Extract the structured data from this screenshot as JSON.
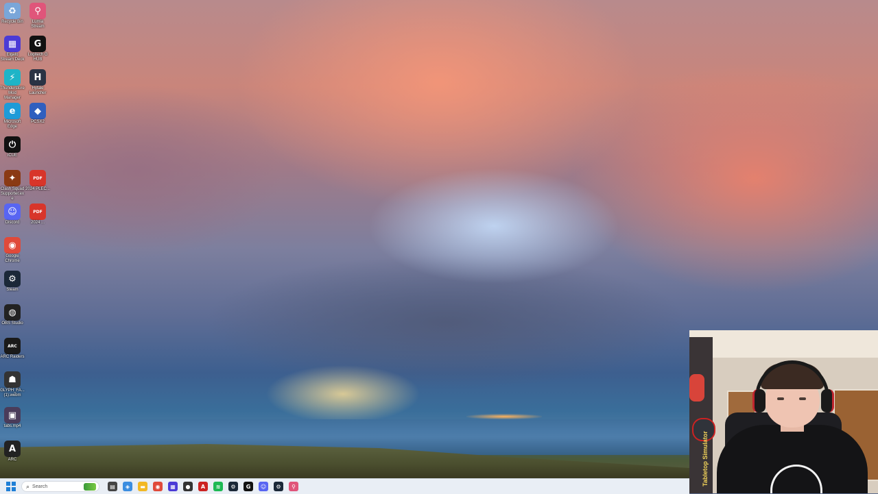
{
  "desktop": {
    "icons": [
      {
        "label": "Recycle Bin",
        "icon": "recycle-bin-icon",
        "color": "#7aa6d9",
        "glyph": "♻"
      },
      {
        "label": "Lumia Stream",
        "icon": "map-pin-icon",
        "color": "#e0557a",
        "glyph": "⚲"
      },
      {
        "label": "Elgato Stream Deck",
        "icon": "stream-deck-icon",
        "color": "#4b3bd6",
        "glyph": "▦"
      },
      {
        "label": "Logitech G HUB",
        "icon": "logitech-g-icon",
        "color": "#111111",
        "glyph": "G"
      },
      {
        "label": "Thunderstore Mod Manager",
        "icon": "thunderstore-icon",
        "color": "#1fb4c7",
        "glyph": "⚡"
      },
      {
        "label": "Hytale Launcher",
        "icon": "hytale-icon",
        "color": "#2a3344",
        "glyph": "H"
      },
      {
        "label": "Microsoft Edge",
        "icon": "edge-icon",
        "color": "#1f9bd8",
        "glyph": "e"
      },
      {
        "label": "PCSX2",
        "icon": "pcsx2-icon",
        "color": "#2f5fbf",
        "glyph": "◆"
      },
      {
        "label": "iCUE",
        "icon": "icue-icon",
        "color": "#111111",
        "glyph": "⏻"
      },
      {
        "label": "Clash Squad Supporter.exe",
        "icon": "game-logo-icon",
        "color": "#8a3a14",
        "glyph": "✦"
      },
      {
        "label": "2024 PLEC...",
        "icon": "pdf-file-icon",
        "color": "#d8352a",
        "glyph": "PDF"
      },
      {
        "label": "Discord",
        "icon": "discord-icon",
        "color": "#5865f2",
        "glyph": "☺"
      },
      {
        "label": "2024 ...",
        "icon": "pdf-file-icon",
        "color": "#d8352a",
        "glyph": "PDF"
      },
      {
        "label": "Google Chrome",
        "icon": "chrome-icon",
        "color": "#e04a3a",
        "glyph": "◉"
      },
      {
        "label": "Steam",
        "icon": "steam-icon",
        "color": "#1b2838",
        "glyph": "⚙"
      },
      {
        "label": "OBS Studio",
        "icon": "obs-icon",
        "color": "#222222",
        "glyph": "◍"
      },
      {
        "label": "ARC Raiders",
        "icon": "arc-raiders-icon",
        "color": "#1a1a1a",
        "glyph": "ARC"
      },
      {
        "label": "GLYPH_FA... (1).webm",
        "icon": "video-file-icon",
        "color": "#333333",
        "glyph": "☗"
      },
      {
        "label": "tabs.mp4",
        "icon": "video-file-icon",
        "color": "#4a3c5a",
        "glyph": "▣"
      },
      {
        "label": "ARC",
        "icon": "arc-font-icon",
        "color": "#222222",
        "glyph": "A"
      }
    ]
  },
  "taskbar": {
    "search_placeholder": "Search",
    "apps": [
      {
        "name": "file-manager-icon",
        "color": "#444444",
        "glyph": "▤"
      },
      {
        "name": "copilot-icon",
        "color": "#3b8de0",
        "glyph": "◈"
      },
      {
        "name": "file-explorer-icon",
        "color": "#f2b824",
        "glyph": "▬"
      },
      {
        "name": "chrome-icon",
        "color": "#e04a3a",
        "glyph": "◉"
      },
      {
        "name": "stream-deck-icon",
        "color": "#4b3bd6",
        "glyph": "▦"
      },
      {
        "name": "app-icon",
        "color": "#333333",
        "glyph": "●"
      },
      {
        "name": "adobe-icon",
        "color": "#cc2222",
        "glyph": "A"
      },
      {
        "name": "spotify-icon",
        "color": "#1db954",
        "glyph": "≋"
      },
      {
        "name": "steam-icon",
        "color": "#1b2838",
        "glyph": "⚙"
      },
      {
        "name": "logitech-g-icon",
        "color": "#111111",
        "glyph": "G"
      },
      {
        "name": "discord-icon",
        "color": "#5865f2",
        "glyph": "☺"
      },
      {
        "name": "steam-icon",
        "color": "#1b2838",
        "glyph": "⚙"
      },
      {
        "name": "map-pin-icon",
        "color": "#e0557a",
        "glyph": "⚲"
      }
    ]
  },
  "webcam": {
    "shelf_text": "Tabletop Simulator"
  }
}
